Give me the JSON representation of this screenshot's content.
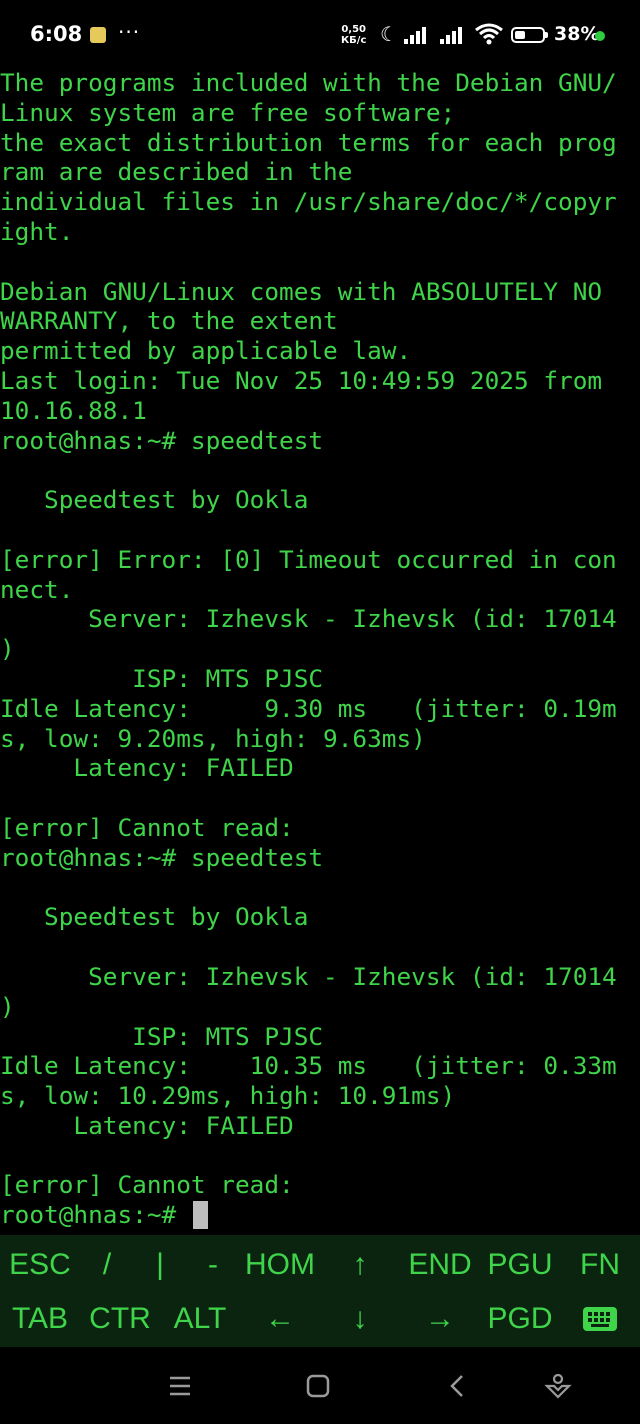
{
  "status_bar": {
    "time": "6:08",
    "more": "···",
    "net_speed_value": "0,50",
    "net_speed_unit": "КБ/с",
    "battery_percent": "38%",
    "battery_level": 0.38,
    "icons": [
      "notification-icon",
      "moon-icon",
      "signal-icon",
      "signal-icon",
      "wifi-icon",
      "battery-icon"
    ]
  },
  "terminal": {
    "lines": [
      "The programs included with the Debian GNU/",
      "Linux system are free software;",
      "the exact distribution terms for each prog",
      "ram are described in the",
      "individual files in /usr/share/doc/*/copyr",
      "ight.",
      "",
      "Debian GNU/Linux comes with ABSOLUTELY NO",
      "WARRANTY, to the extent",
      "permitted by applicable law.",
      "Last login: Tue Nov 25 10:49:59 2025 from",
      "10.16.88.1",
      "root@hnas:~# speedtest",
      "",
      "   Speedtest by Ookla",
      "",
      "[error] Error: [0] Timeout occurred in con",
      "nect.",
      "      Server: Izhevsk - Izhevsk (id: 17014",
      ")",
      "         ISP: MTS PJSC",
      "Idle Latency:     9.30 ms   (jitter: 0.19m",
      "s, low: 9.20ms, high: 9.63ms)",
      "     Latency: FAILED",
      "",
      "[error] Cannot read:",
      "root@hnas:~# speedtest",
      "",
      "   Speedtest by Ookla",
      "",
      "      Server: Izhevsk - Izhevsk (id: 17014",
      ")",
      "         ISP: MTS PJSC",
      "Idle Latency:    10.35 ms   (jitter: 0.33m",
      "s, low: 10.29ms, high: 10.91ms)",
      "     Latency: FAILED",
      "",
      "[error] Cannot read:"
    ],
    "prompt": "root@hnas:~# ",
    "text_color": "#3fd44a"
  },
  "extra_keys": {
    "row1": [
      "ESC",
      "/",
      "|",
      "-",
      "HOM",
      "↑",
      "END",
      "PGU",
      "FN"
    ],
    "row2": [
      "TAB",
      "CTR",
      "ALT",
      "←",
      "↓",
      "→",
      "PGD",
      "keyboard-icon"
    ]
  },
  "nav_bar": {
    "buttons": [
      "menu-icon",
      "home-icon",
      "back-icon",
      "assistant-icon"
    ]
  }
}
